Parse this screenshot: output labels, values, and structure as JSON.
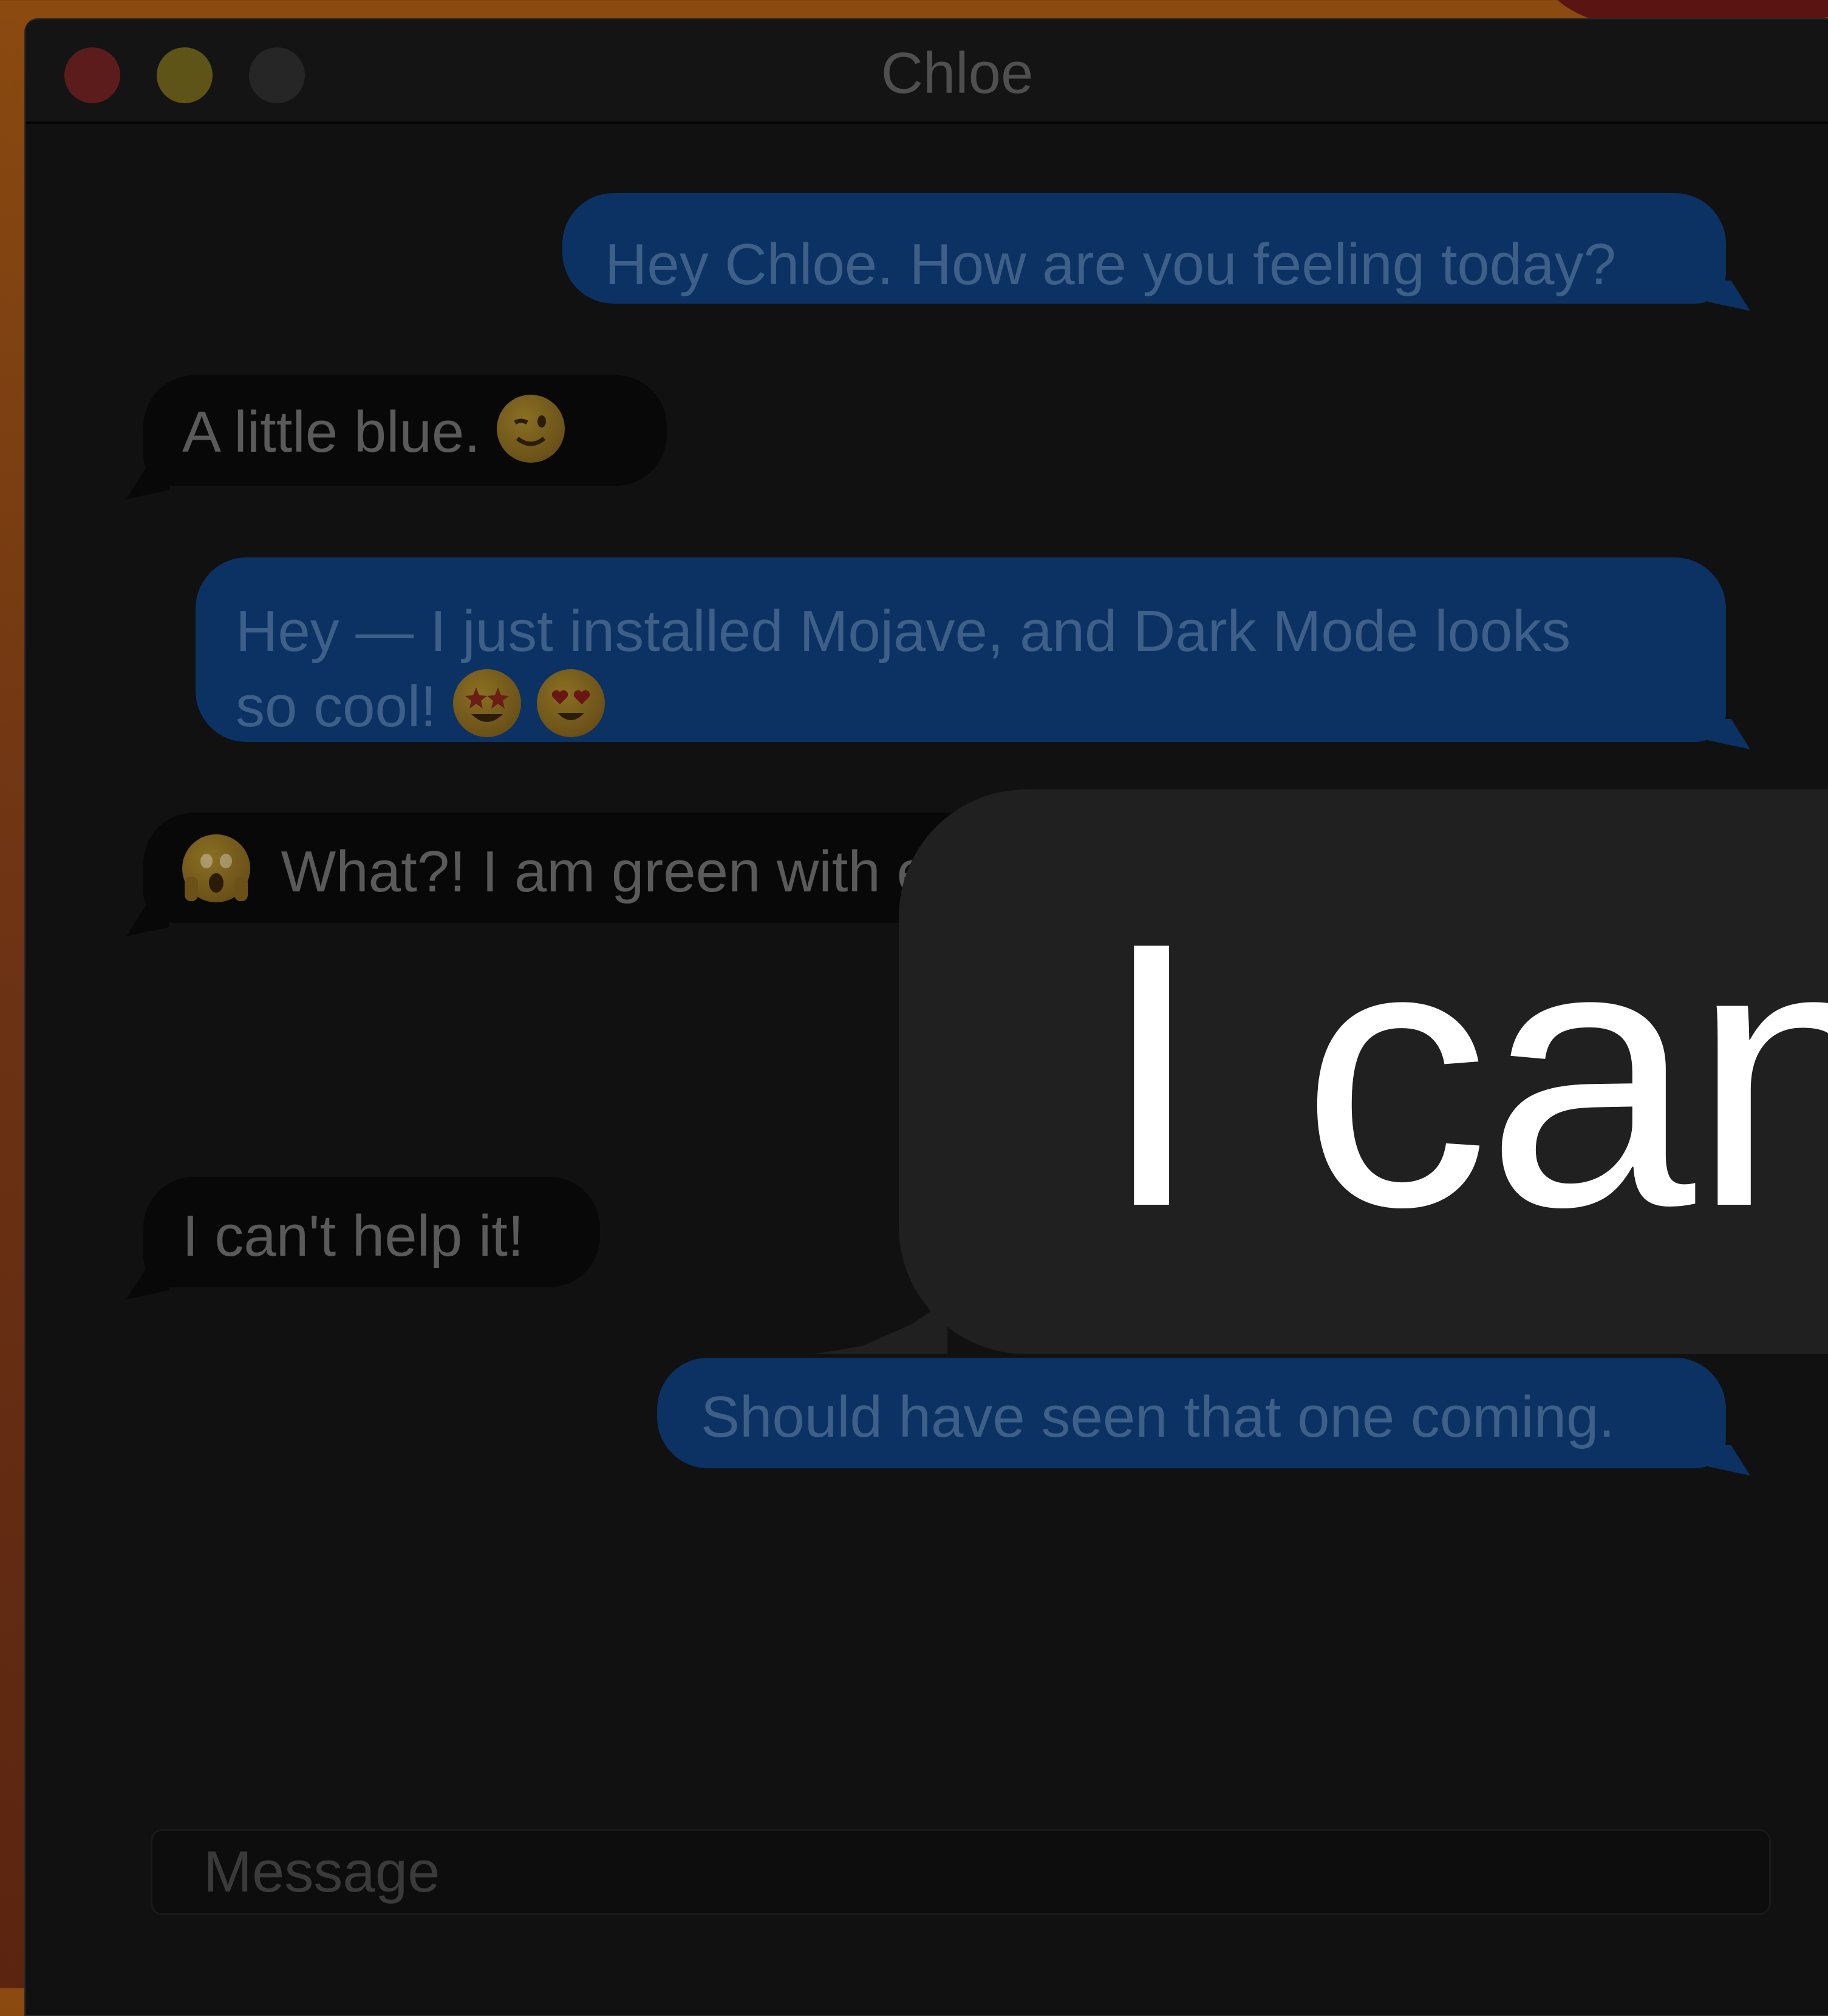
{
  "window": {
    "title": "Chloe"
  },
  "messages": [
    {
      "direction": "sent",
      "text": "Hey Chloe. How are you feeling today?"
    },
    {
      "direction": "received",
      "text": "A little blue.",
      "emoji": "winking-face-icon"
    },
    {
      "direction": "sent",
      "text_line1": "Hey — I just installed Mojave, and Dark Mode looks",
      "text_line2": "so cool!",
      "emoji": [
        "star-struck-face-icon",
        "heart-eyes-face-icon"
      ]
    },
    {
      "direction": "received",
      "emoji": "screaming-face-icon",
      "text": "What?! I am green with e"
    },
    {
      "direction": "received",
      "text": "I can't help it!"
    },
    {
      "direction": "sent",
      "text": "Should have seen that one coming."
    }
  ],
  "overlay": {
    "text": "I can'"
  },
  "compose": {
    "placeholder": "Message"
  },
  "colors": {
    "sent_bubble": "#0b3263",
    "received_bubble": "#080808",
    "overlay_bubble": "#202020",
    "window_background": "#111111"
  }
}
